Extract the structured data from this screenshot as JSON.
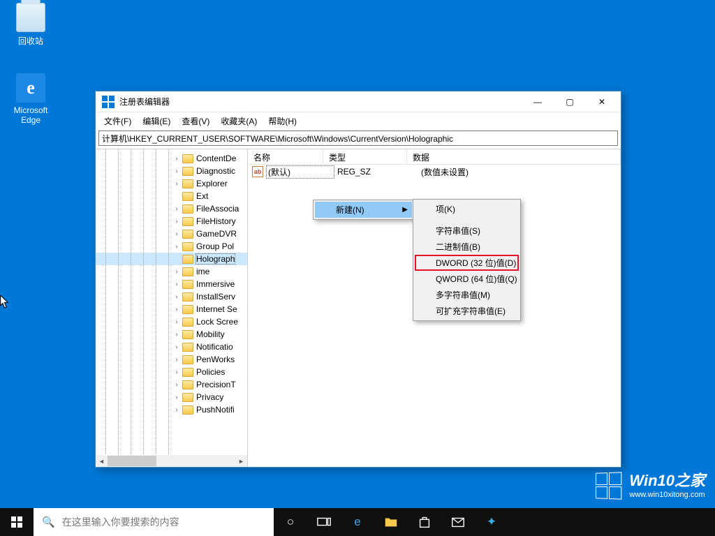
{
  "desktop": {
    "recycle_bin": "回收站",
    "edge": "Microsoft\nEdge"
  },
  "window": {
    "title": "注册表编辑器",
    "menus": {
      "file": "文件(F)",
      "edit": "编辑(E)",
      "view": "查看(V)",
      "favorites": "收藏夹(A)",
      "help": "帮助(H)"
    },
    "address": "计算机\\HKEY_CURRENT_USER\\SOFTWARE\\Microsoft\\Windows\\CurrentVersion\\Holographic"
  },
  "tree": {
    "items": [
      {
        "label": "ContentDe",
        "expand": "›"
      },
      {
        "label": "Diagnostic",
        "expand": "›"
      },
      {
        "label": "Explorer",
        "expand": "›"
      },
      {
        "label": "Ext",
        "expand": ""
      },
      {
        "label": "FileAssocia",
        "expand": "›"
      },
      {
        "label": "FileHistory",
        "expand": "›"
      },
      {
        "label": "GameDVR",
        "expand": "›"
      },
      {
        "label": "Group Pol",
        "expand": "›"
      },
      {
        "label": "Holograph",
        "expand": "",
        "selected": true
      },
      {
        "label": "ime",
        "expand": "›"
      },
      {
        "label": "Immersive",
        "expand": "›"
      },
      {
        "label": "InstallServ",
        "expand": "›"
      },
      {
        "label": "Internet Se",
        "expand": "›"
      },
      {
        "label": "Lock Scree",
        "expand": "›"
      },
      {
        "label": "Mobility",
        "expand": "›"
      },
      {
        "label": "Notificatio",
        "expand": "›"
      },
      {
        "label": "PenWorks",
        "expand": "›"
      },
      {
        "label": "Policies",
        "expand": "›"
      },
      {
        "label": "PrecisionT",
        "expand": "›"
      },
      {
        "label": "Privacy",
        "expand": "›"
      },
      {
        "label": "PushNotifi",
        "expand": "›"
      }
    ]
  },
  "list": {
    "headers": {
      "name": "名称",
      "type": "类型",
      "data": "数据"
    },
    "rows": [
      {
        "name": "(默认)",
        "type": "REG_SZ",
        "data": "(数值未设置)"
      }
    ]
  },
  "context_menu": {
    "new": "新建(N)",
    "sub": {
      "key": "项(K)",
      "string": "字符串值(S)",
      "binary": "二进制值(B)",
      "dword": "DWORD (32 位)值(D)",
      "qword": "QWORD (64 位)值(Q)",
      "multi": "多字符串值(M)",
      "expand": "可扩充字符串值(E)"
    }
  },
  "taskbar": {
    "search_placeholder": "在这里输入你要搜索的内容"
  },
  "watermark": {
    "brand": "Win10之家",
    "url": "www.win10xitong.com"
  }
}
